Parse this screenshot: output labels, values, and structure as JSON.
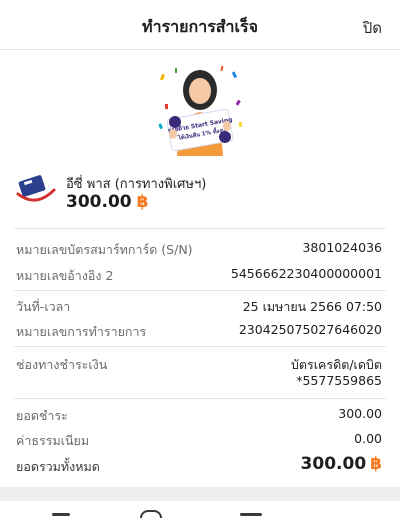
{
  "header": {
    "title": "ทำรายการสำเร็จ",
    "close_label": "ปิด"
  },
  "banner": {
    "line1": "จ่ายด้วย Start Saving",
    "line2": "ได้เงินคืน 1% ทั้งงบ"
  },
  "merchant": {
    "name": "อีซี่ พาส (การทางพิเศษฯ)",
    "amount": "300.00",
    "currency_symbol": "฿"
  },
  "details": {
    "card_sn": {
      "label": "หมายเลขบัตรสมาร์ทการ์ด (S/N)",
      "value": "3801024036"
    },
    "ref2": {
      "label": "หมายเลขอ้างอิง 2",
      "value": "5456662230400000001"
    },
    "datetime": {
      "label": "วันที่-เวลา",
      "value": "25 เมษายน 2566 07:50"
    },
    "txn_no": {
      "label": "หมายเลขการทำรายการ",
      "value": "230425075027646020"
    },
    "channel": {
      "label": "ช่องทางชำระเงิน",
      "value": "บัตรเครดิต/เดบิต",
      "value2": "*5577559865"
    }
  },
  "summary": {
    "paid": {
      "label": "ยอดชำระ",
      "value": "300.00"
    },
    "fee": {
      "label": "ค่าธรรมเนียม",
      "value": "0.00"
    },
    "total": {
      "label": "ยอดรวมทั้งหมด",
      "value": "300.00",
      "currency_symbol": "฿"
    }
  },
  "colors": {
    "accent": "#f47a1f",
    "text": "#1f1f1f",
    "muted": "#6b6b6b"
  }
}
